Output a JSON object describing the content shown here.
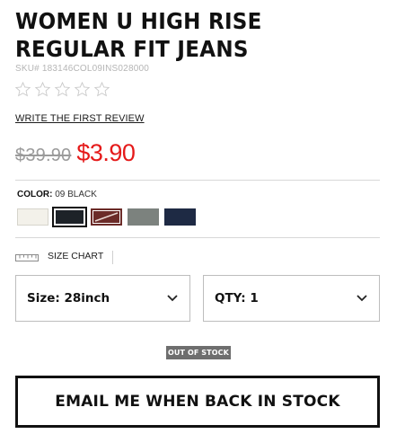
{
  "product": {
    "title_line1": "WOMEN U HIGH RISE",
    "title_line2": "REGULAR FIT JEANS",
    "sku": "SKU# 183146COL09INS028000",
    "rating_stars": 0,
    "review_link": "WRITE THE FIRST REVIEW"
  },
  "price": {
    "original": "$39.90",
    "sale": "$3.90",
    "sale_color": "#e51a1a"
  },
  "color": {
    "label": "COLOR:",
    "value": "09 BLACK",
    "swatches": [
      {
        "name": "off-white",
        "color": "#f3f1ea",
        "selected": false
      },
      {
        "name": "black",
        "color": "#1d2228",
        "selected": true
      },
      {
        "name": "brown-pattern",
        "color": "#6b2b28",
        "selected": false
      },
      {
        "name": "gray",
        "color": "#7c827e",
        "selected": false
      },
      {
        "name": "navy",
        "color": "#1e2a44",
        "selected": false
      }
    ]
  },
  "size_chart": {
    "label": "SIZE CHART",
    "icon": "ruler-icon"
  },
  "selectors": {
    "size": "Size: 28inch",
    "qty": "QTY: 1"
  },
  "stock": {
    "badge": "OUT OF STOCK"
  },
  "cta": {
    "email_label": "EMAIL ME WHEN BACK IN STOCK"
  }
}
